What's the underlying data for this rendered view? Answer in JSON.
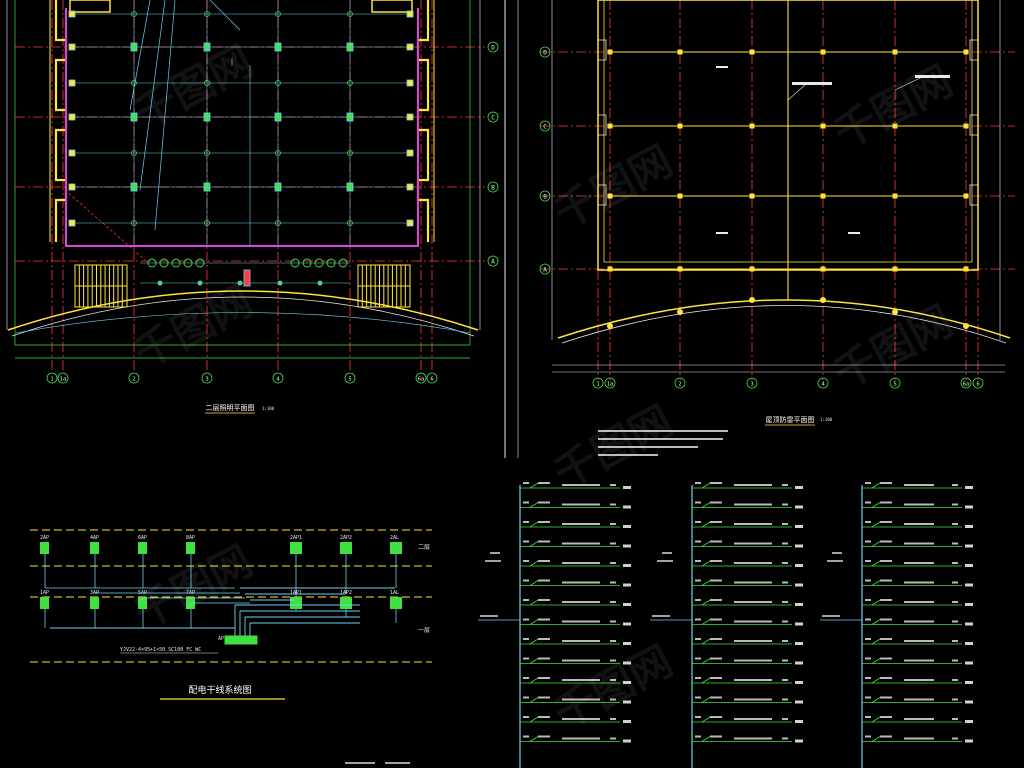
{
  "colors": {
    "background": "#000000",
    "axis": "#ff3b3b",
    "grid": "#6fd0f0",
    "wall": "#ffe23a",
    "wall_purple": "#e040e0",
    "green": "#3fe040",
    "white": "#e8e8e8",
    "cyan": "#00ffff"
  },
  "watermark": "千图网",
  "upper_left_plan": {
    "title": "二层照明平面图",
    "scale": "1:100",
    "axis_letters": [
      "D",
      "C",
      "B",
      "A"
    ],
    "axis_numbers": [
      "1",
      "1a",
      "2",
      "3",
      "4",
      "5",
      "6a",
      "6"
    ]
  },
  "upper_right_plan": {
    "title": "屋顶防雷平面图",
    "scale": "1:100",
    "axis_letters": [
      "D",
      "C",
      "B",
      "A"
    ],
    "axis_numbers": [
      "1",
      "1a",
      "2",
      "3",
      "4",
      "5",
      "6a",
      "6"
    ]
  },
  "distribution_diagram": {
    "title": "配电干线系统图",
    "floor_labels": [
      "二层",
      "一层"
    ],
    "upper_boxes": [
      "2AP",
      "4AP",
      "6AP",
      "8AP",
      "2AP1",
      "2AP2",
      "2AL"
    ],
    "lower_boxes": [
      "1AP",
      "3AP",
      "5AP",
      "7AP",
      "1AP1",
      "1AP2",
      "1AL"
    ],
    "main_box": "AP",
    "cable_label": "YJV22-4×95+1×50 SC100 FC WC"
  }
}
